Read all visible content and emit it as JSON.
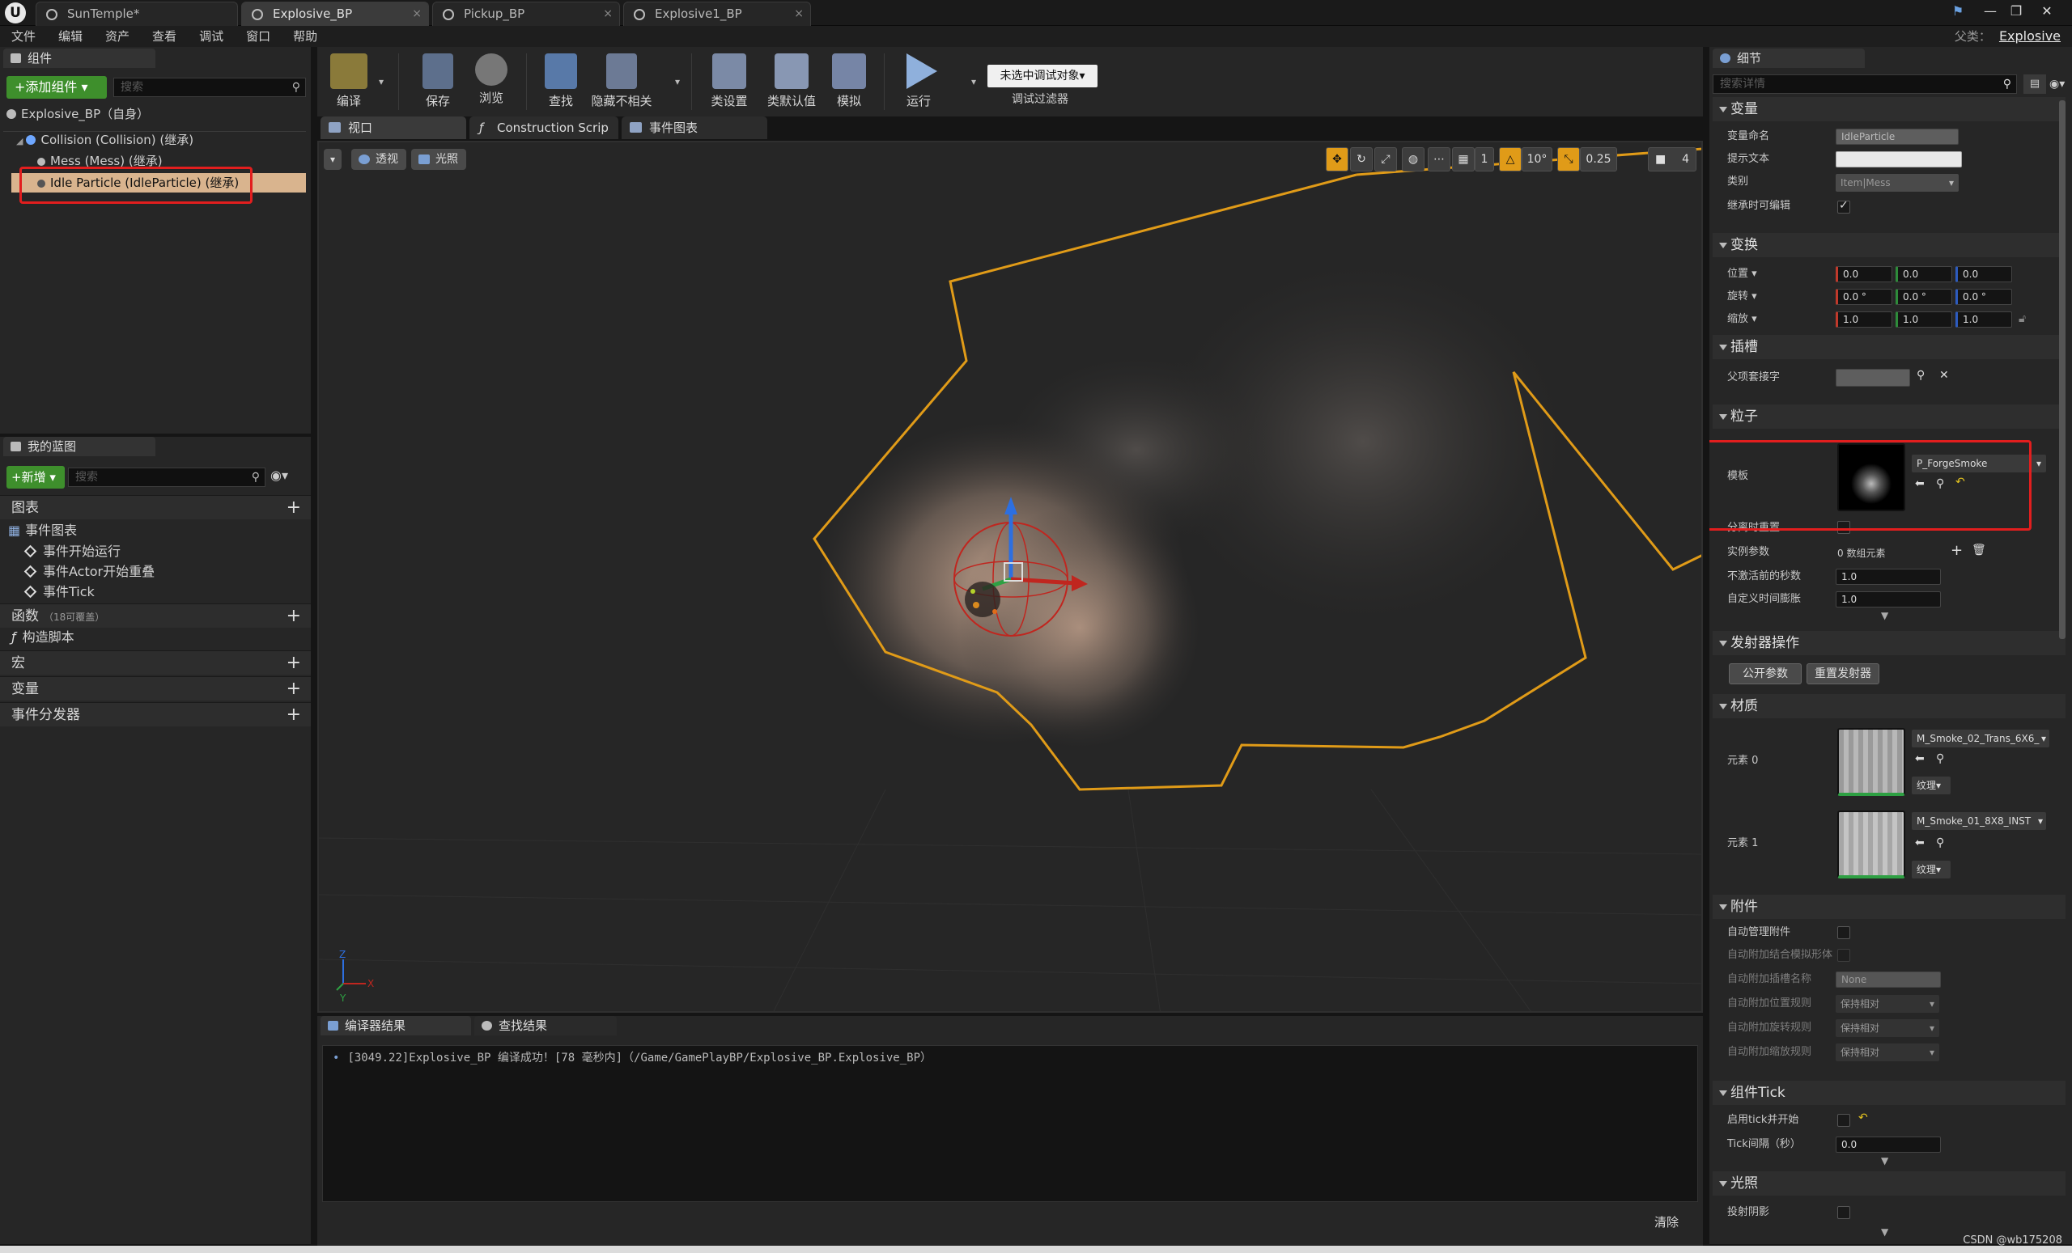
{
  "titlebar": {
    "tabs": [
      {
        "label": "SunTemple*"
      },
      {
        "label": "Explosive_BP"
      },
      {
        "label": "Pickup_BP"
      },
      {
        "label": "Explosive1_BP"
      }
    ],
    "parent_label": "父类：",
    "parent_value": "Explosive"
  },
  "menubar": {
    "items": [
      "文件",
      "编辑",
      "资产",
      "查看",
      "调试",
      "窗口",
      "帮助"
    ]
  },
  "components_panel": {
    "tab_label": "组件",
    "add_button": "+添加组件 ▾",
    "search_placeholder": "搜索",
    "root": "Explosive_BP（自身）",
    "items": [
      "Collision (Collision) (继承)",
      "Mess (Mess) (继承)",
      "Idle Particle (IdleParticle) (继承)"
    ]
  },
  "my_blueprint": {
    "tab_label": "我的蓝图",
    "new_button": "+新增 ▾",
    "search_placeholder": "搜索",
    "graphs_label": "图表",
    "event_graph": "事件图表",
    "events": [
      "事件开始运行",
      "事件Actor开始重叠",
      "事件Tick"
    ],
    "functions_label": "函数",
    "functions_note": "（18可覆盖）",
    "construction_script": "构造脚本",
    "macros_label": "宏",
    "variables_label": "变量",
    "dispatchers_label": "事件分发器"
  },
  "toolbar": {
    "buttons": [
      "编译",
      "保存",
      "浏览",
      "查找",
      "隐藏不相关",
      "类设置",
      "类默认值",
      "模拟",
      "运行"
    ],
    "debug_select": "未选中调试对象▾",
    "debug_filter": "调试过滤器"
  },
  "center_tabs": [
    "视口",
    "Construction Scrip",
    "事件图表"
  ],
  "viewport": {
    "perspective_btn": "透视",
    "lit_btn": "光照",
    "snap_angle": "10°",
    "snap_scale": "0.25",
    "camera_speed": "4",
    "grid_number": "1"
  },
  "output": {
    "tabs": [
      "编译器结果",
      "查找结果"
    ],
    "log_line": "[3049.22]Explosive_BP 编译成功！[78 毫秒内]（/Game/GamePlayBP/Explosive_BP.Explosive_BP）",
    "clear_button": "清除"
  },
  "details": {
    "tab_label": "细节",
    "search_placeholder": "搜索详情",
    "sections": {
      "variable": "变量",
      "transform": "变换",
      "socket": "插槽",
      "particles": "粒子",
      "emitter_actions": "发射器操作",
      "materials": "材质",
      "attachment": "附件",
      "component_tick": "组件Tick",
      "lighting": "光照"
    },
    "var_name_label": "变量命名",
    "var_name_value": "IdleParticle",
    "tooltip_label": "提示文本",
    "category_label": "类别",
    "category_value": "Item|Mess",
    "editable_inherit_label": "继承时可编辑",
    "location_label": "位置 ▾",
    "rotation_label": "旋转 ▾",
    "scale_label": "缩放 ▾",
    "location": [
      "0.0",
      "0.0",
      "0.0"
    ],
    "rotation": [
      "0.0 °",
      "0.0 °",
      "0.0 °"
    ],
    "scale": [
      "1.0",
      "1.0",
      "1.0"
    ],
    "parent_socket_label": "父项套接字",
    "template_label": "模板",
    "template_value": "P_ForgeSmoke",
    "reset_on_detach_label": "分离时重置",
    "instance_params_label": "实例参数",
    "instance_params_value": "0 数组元素",
    "seconds_before_inactive_label": "不激活前的秒数",
    "seconds_before_inactive": "1.0",
    "custom_time_dilation_label": "自定义时间膨胀",
    "custom_time_dilation": "1.0",
    "expose_params_btn": "公开参数",
    "reset_emitters_btn": "重置发射器",
    "element0_label": "元素 0",
    "element0_value": "M_Smoke_02_Trans_6X6_",
    "element1_label": "元素 1",
    "element1_value": "M_Smoke_01_8X8_INST",
    "texture_btn": "纹理▾",
    "auto_manage_label": "自动管理附件",
    "auto_weld_label": "自动附加结合模拟形体",
    "auto_socket_label": "自动附加插槽名称",
    "auto_socket_value": "None",
    "auto_loc_rule_label": "自动附加位置规则",
    "auto_rot_rule_label": "自动附加旋转规则",
    "auto_scale_rule_label": "自动附加缩放规则",
    "rule_value": "保持相对",
    "start_tick_label": "启用tick并开始",
    "tick_interval_label": "Tick间隔（秒）",
    "tick_interval": "0.0",
    "cast_shadow_label": "投射阴影"
  },
  "watermark": "CSDN @wb175208",
  "colors": {
    "accent_orange": "#e09b18",
    "highlight_red": "#e21e1e",
    "add_green": "#3e8f2c",
    "selected_row": "#d9b48e"
  }
}
